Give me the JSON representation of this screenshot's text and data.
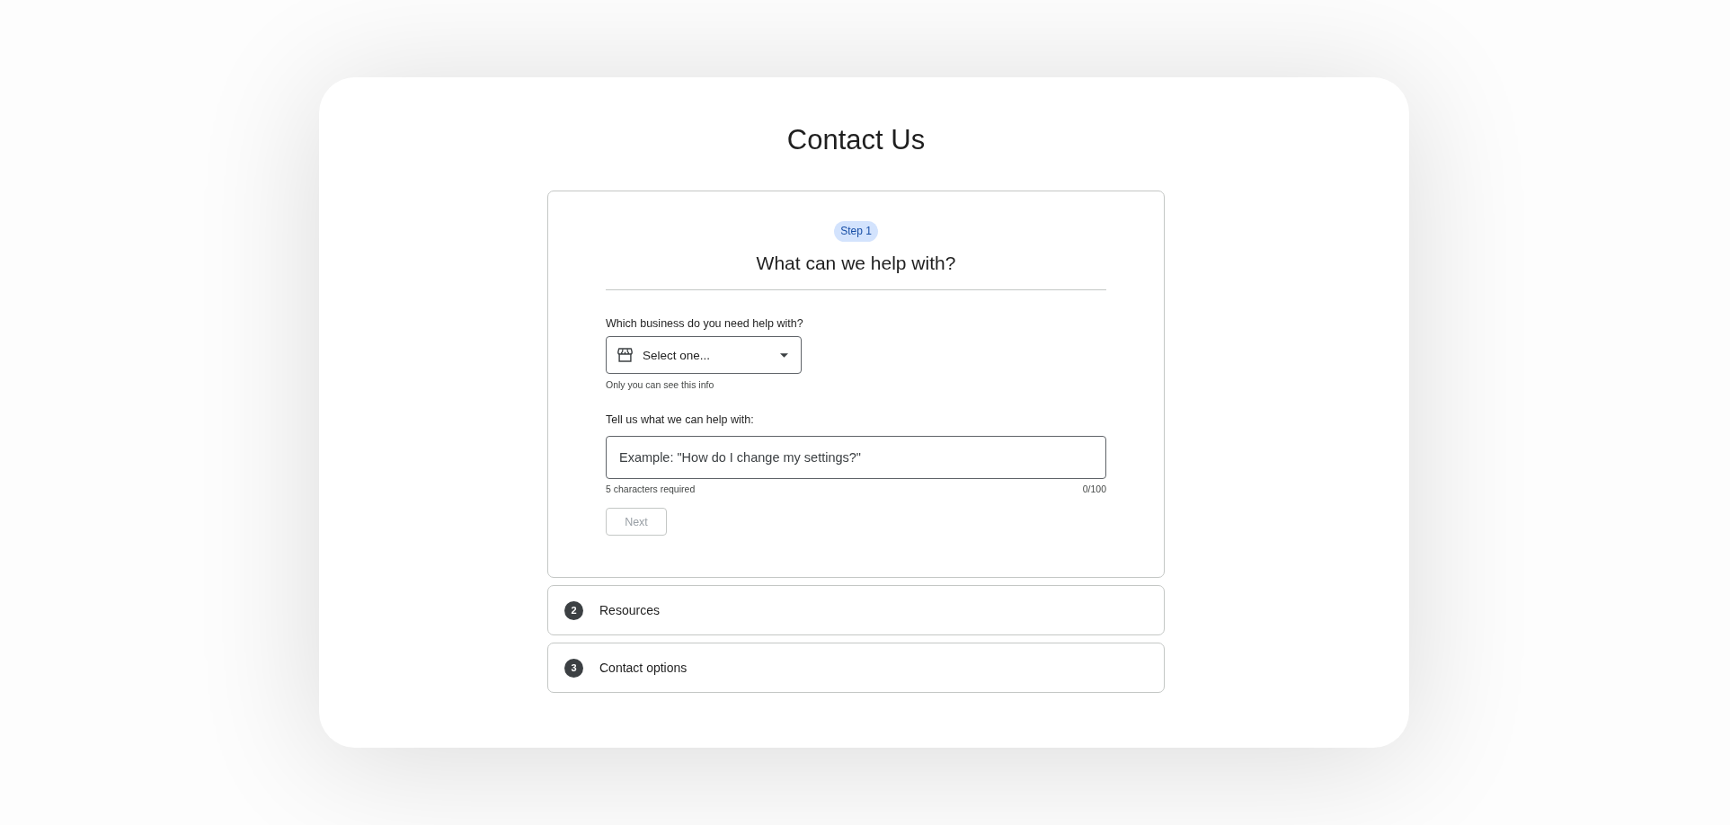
{
  "title": "Contact Us",
  "current_step": {
    "badge": "Step 1",
    "heading": "What can we help with?",
    "business_field": {
      "label": "Which business do you need help with?",
      "placeholder": "Select one...",
      "helper": "Only you can see this info"
    },
    "question_field": {
      "label": "Tell us what we can help with:",
      "placeholder": "Example: \"How do I change my settings?\"",
      "helper": "5 characters required",
      "counter": "0/100"
    },
    "next_button": {
      "label": "Next",
      "disabled": true
    }
  },
  "later_steps": [
    {
      "number": "2",
      "label": "Resources"
    },
    {
      "number": "3",
      "label": "Contact options"
    }
  ]
}
